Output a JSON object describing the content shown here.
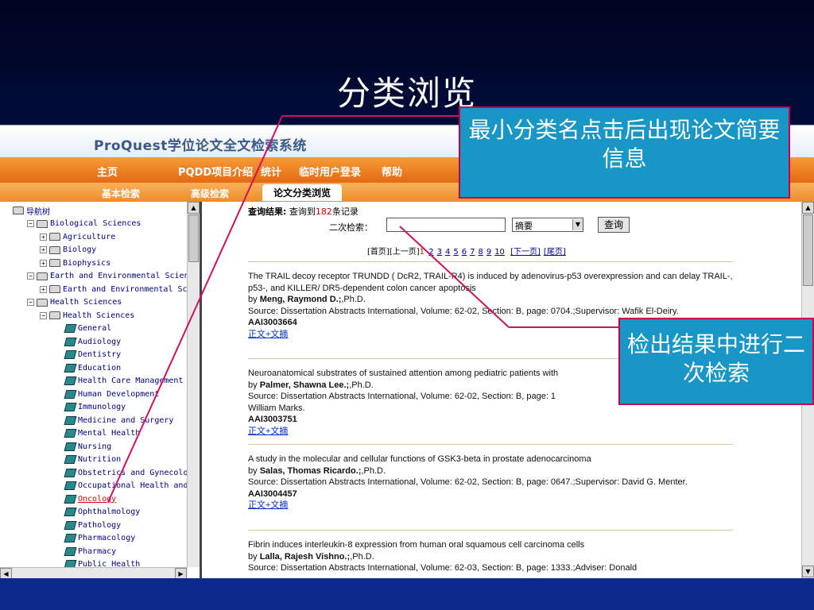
{
  "slide": {
    "title": "分类浏览"
  },
  "app": {
    "logo": "ProQuest学位论文全文检索系统",
    "nav": [
      "主页",
      "PQDD项目介绍",
      "统计",
      "临时用户登录",
      "帮助"
    ],
    "subnav": [
      "基本检索",
      "高级检索",
      "论文分类浏览"
    ]
  },
  "tree": {
    "root": "导航树",
    "items": [
      {
        "label": "Biological Sciences",
        "level": 1,
        "expander": "−",
        "icon": "folder-icon"
      },
      {
        "label": "Agriculture",
        "level": 2,
        "expander": "+",
        "icon": "folder-icon"
      },
      {
        "label": "Biology",
        "level": 2,
        "expander": "+",
        "icon": "folder-icon"
      },
      {
        "label": "Biophysics",
        "level": 2,
        "expander": "+",
        "icon": "folder-icon"
      },
      {
        "label": "Earth and Environmental Sciences",
        "level": 1,
        "expander": "−",
        "icon": "folder-icon"
      },
      {
        "label": "Earth and Environmental Scien",
        "level": 2,
        "expander": "+",
        "icon": "folder-icon"
      },
      {
        "label": "Health Sciences",
        "level": 1,
        "expander": "−",
        "icon": "folder-icon"
      },
      {
        "label": "Health Sciences",
        "level": 2,
        "expander": "−",
        "icon": "folder-icon"
      },
      {
        "label": "General",
        "level": 3,
        "icon": "book-icon"
      },
      {
        "label": "Audiology",
        "level": 3,
        "icon": "book-icon"
      },
      {
        "label": "Dentistry",
        "level": 3,
        "icon": "book-icon"
      },
      {
        "label": "Education",
        "level": 3,
        "icon": "book-icon"
      },
      {
        "label": "Health Care Management",
        "level": 3,
        "icon": "book-icon"
      },
      {
        "label": "Human Development",
        "level": 3,
        "icon": "book-icon"
      },
      {
        "label": "Immunology",
        "level": 3,
        "icon": "book-icon"
      },
      {
        "label": "Medicine and Surgery",
        "level": 3,
        "icon": "book-icon"
      },
      {
        "label": "Mental Health",
        "level": 3,
        "icon": "book-icon"
      },
      {
        "label": "Nursing",
        "level": 3,
        "icon": "book-icon"
      },
      {
        "label": "Nutrition",
        "level": 3,
        "icon": "book-icon"
      },
      {
        "label": "Obstetrics and Gynecology",
        "level": 3,
        "icon": "book-icon"
      },
      {
        "label": "Occupational Health and Sa",
        "level": 3,
        "icon": "book-icon"
      },
      {
        "label": "Oncology",
        "level": 3,
        "icon": "book-icon",
        "selected": true
      },
      {
        "label": "Ophthalmology",
        "level": 3,
        "icon": "book-icon"
      },
      {
        "label": "Pathology",
        "level": 3,
        "icon": "book-icon"
      },
      {
        "label": "Pharmacology",
        "level": 3,
        "icon": "book-icon"
      },
      {
        "label": "Pharmacy",
        "level": 3,
        "icon": "book-icon"
      },
      {
        "label": "Public Health",
        "level": 3,
        "icon": "book-icon"
      }
    ]
  },
  "results": {
    "summary_label": "查询结果:",
    "summary_pre": "查询到",
    "summary_count": "182",
    "summary_post": "条记录",
    "secondary_search_label": "二次检索：",
    "secondary_search_value": "",
    "field_select_value": "摘要",
    "search_button": "查询",
    "pager": {
      "first": "[首页]",
      "prev": "[上一页]",
      "current": "1",
      "pages": [
        "2",
        "3",
        "4",
        "5",
        "6",
        "7",
        "8",
        "9",
        "10"
      ],
      "next": "[下一页]",
      "last": "[尾页]"
    },
    "records": [
      {
        "title": "The TRAIL decoy receptor TRUNDD ( DcR2, TRAIL-R4) is induced by adenovirus-p53 overexpression and can delay TRAIL-, p53-, and KILLER/ DR5-dependent colon cancer apoptosis",
        "by": "by",
        "author": "Meng, Raymond D.;",
        "degree": ",Ph.D.",
        "source": "Source: Dissertation Abstracts International, Volume: 62-02, Section: B, page: 0704.;Supervisor: Wafik El-Deiry.",
        "id": "AAI3003664",
        "link": "正文+文摘"
      },
      {
        "title": "Neuroanatomical substrates of sustained attention among pediatric patients with",
        "by": "by",
        "author": "Palmer, Shawna Lee.;",
        "degree": ",Ph.D.",
        "source": "Source: Dissertation Abstracts International, Volume: 62-02, Section: B, page: 1",
        "source2": "William Marks.",
        "id": "AAI3003751",
        "link": "正文+文摘"
      },
      {
        "title": "A study in the molecular and cellular functions of GSK3-beta in prostate adenocarcinoma",
        "by": "by",
        "author": "Salas, Thomas Ricardo.;",
        "degree": ",Ph.D.",
        "source": "Source: Dissertation Abstracts International, Volume: 62-02, Section: B, page: 0647.;Supervisor: David G. Menter.",
        "id": "AAI3004457",
        "link": "正文+文摘"
      },
      {
        "title": "Fibrin induces interleukin-8 expression from human oral squamous cell carcinoma cells",
        "by": "by",
        "author": "Lalla, Rajesh Vishno.;",
        "degree": ",Ph.D.",
        "source": "Source: Dissertation Abstracts International, Volume: 62-03, Section: B, page: 1333.;Adviser: Donald"
      }
    ]
  },
  "callouts": {
    "top": "最小分类名点击后出现论文简要信息",
    "bottom": "检出结果中进行二次检索"
  },
  "colors": {
    "callout_bg": "#1896c6",
    "callout_border": "#c8004c",
    "nav_orange": "#e26a12",
    "link_blue": "#0033cc",
    "count_red": "#e00000"
  }
}
